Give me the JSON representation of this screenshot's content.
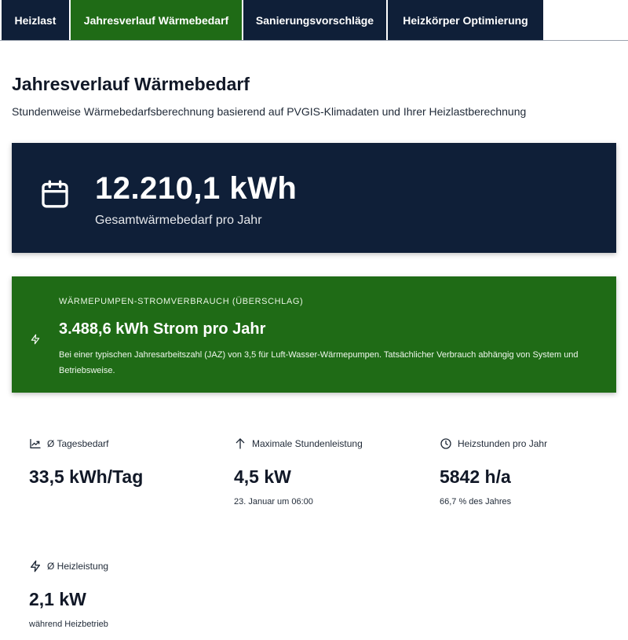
{
  "tabs": [
    {
      "label": "Heizlast",
      "active": false
    },
    {
      "label": "Jahresverlauf Wärmebedarf",
      "active": true
    },
    {
      "label": "Sanierungsvorschläge",
      "active": false
    },
    {
      "label": "Heizkörper Optimierung",
      "active": false
    }
  ],
  "page": {
    "title": "Jahresverlauf Wärmebedarf",
    "subtitle": "Stundenweise Wärmebedarfsberechnung basierend auf PVGIS-Klimadaten und Ihrer Heizlastberechnung"
  },
  "total": {
    "icon": "calendar-icon",
    "value": "12.210,1 kWh",
    "label": "Gesamtwärmebedarf pro Jahr"
  },
  "heatpump": {
    "icon": "bolt-icon",
    "heading": "WÄRMEPUMPEN-STROMVERBRAUCH (ÜBERSCHLAG)",
    "value": "3.488,6 kWh Strom pro Jahr",
    "description": "Bei einer typischen Jahresarbeitszahl (JAZ) von 3,5 für Luft-Wasser-Wärmepumpen. Tatsächlicher Verbrauch abhängig von System und Betriebsweise."
  },
  "stats": [
    {
      "icon": "trending-up-icon",
      "label": "Ø Tagesbedarf",
      "value": "33,5 kWh/Tag",
      "note": ""
    },
    {
      "icon": "arrow-up-icon",
      "label": "Maximale Stundenleistung",
      "value": "4,5 kW",
      "note": "23. Januar um 06:00"
    },
    {
      "icon": "clock-icon",
      "label": "Heizstunden pro Jahr",
      "value": "5842 h/a",
      "note": "66,7 % des Jahres"
    },
    {
      "icon": "bolt-icon",
      "label": "Ø Heizleistung",
      "value": "2,1 kW",
      "note": "während Heizbetrieb"
    }
  ],
  "colors": {
    "navy": "#0f1f38",
    "green": "#1f6b16"
  }
}
